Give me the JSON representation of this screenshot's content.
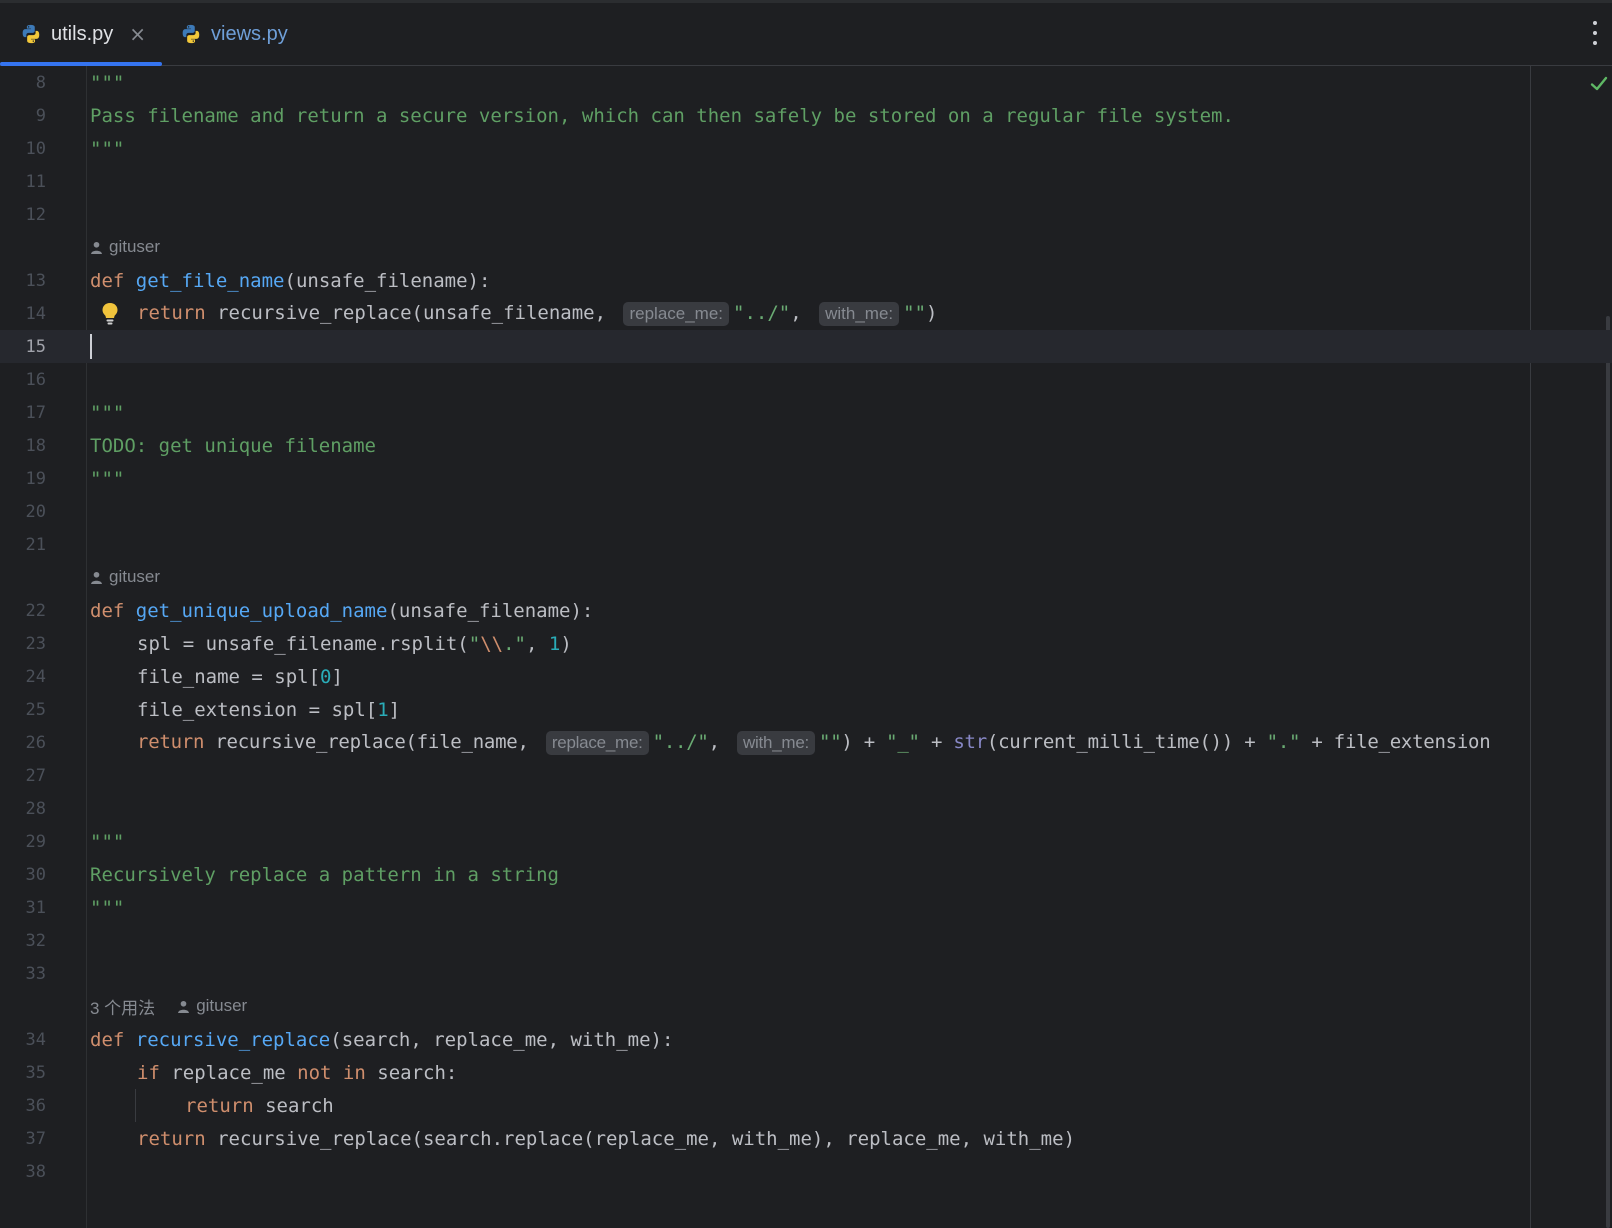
{
  "tabs": [
    {
      "label": "utils.py",
      "close": "×",
      "active": true
    },
    {
      "label": "views.py",
      "active": false
    }
  ],
  "author": "gituser",
  "usages": "3 个用法",
  "lines": {
    "l8": {
      "num": "8",
      "text": "\"\"\""
    },
    "l9": {
      "num": "9",
      "text": "Pass filename and return a secure version, which can then safely be stored on a regular file system."
    },
    "l10": {
      "num": "10",
      "text": "\"\"\""
    },
    "l11": {
      "num": "11"
    },
    "l12": {
      "num": "12"
    },
    "l13": {
      "num": "13",
      "kw": "def",
      "fn": "get_file_name",
      "rest": "(unsafe_filename):"
    },
    "l14": {
      "num": "14",
      "kw": "return",
      "call": "recursive_replace(unsafe_filename, ",
      "hint1": "replace_me:",
      "str1": "\"../\"",
      "sep": ", ",
      "hint2": "with_me:",
      "str2": "\"\"",
      "close": ")"
    },
    "l15": {
      "num": "15"
    },
    "l16": {
      "num": "16"
    },
    "l17": {
      "num": "17",
      "text": "\"\"\""
    },
    "l18": {
      "num": "18",
      "text": "TODO: get unique filename"
    },
    "l19": {
      "num": "19",
      "text": "\"\"\""
    },
    "l20": {
      "num": "20"
    },
    "l21": {
      "num": "21"
    },
    "l22": {
      "num": "22",
      "kw": "def",
      "fn": "get_unique_upload_name",
      "rest": "(unsafe_filename):"
    },
    "l23": {
      "num": "23",
      "a": "spl = unsafe_filename.rsplit(",
      "q1": "\"",
      "esc": "\\\\",
      "q2": ".\"",
      "b": ", ",
      "n": "1",
      "c": ")"
    },
    "l24": {
      "num": "24",
      "a": "file_name = spl[",
      "n": "0",
      "c": "]"
    },
    "l25": {
      "num": "25",
      "a": "file_extension = spl[",
      "n": "1",
      "c": "]"
    },
    "l26": {
      "num": "26",
      "kw": "return",
      "call": "recursive_replace(file_name, ",
      "hint1": "replace_me:",
      "str1": "\"../\"",
      "sep": ", ",
      "hint2": "with_me:",
      "str2": "\"\"",
      "p1": ") + ",
      "str3": "\"_\"",
      "p2": " + ",
      "bi": "str",
      "p3": "(current_milli_time()) + ",
      "str4": "\".\"",
      "p4": " + file_extension"
    },
    "l27": {
      "num": "27"
    },
    "l28": {
      "num": "28"
    },
    "l29": {
      "num": "29",
      "text": "\"\"\""
    },
    "l30": {
      "num": "30",
      "text": "Recursively replace a pattern in a string"
    },
    "l31": {
      "num": "31",
      "text": "\"\"\""
    },
    "l32": {
      "num": "32"
    },
    "l33": {
      "num": "33"
    },
    "l34": {
      "num": "34",
      "kw": "def",
      "fn": "recursive_replace",
      "rest": "(search, replace_me, with_me):"
    },
    "l35": {
      "num": "35",
      "kw": "if",
      "a": " replace_me ",
      "kw2": "not in",
      "b": " search:"
    },
    "l36": {
      "num": "36",
      "kw": "return",
      "a": " search"
    },
    "l37": {
      "num": "37",
      "kw": "return",
      "a": " recursive_replace(search.replace(replace_me, with_me), replace_me, with_me)"
    },
    "l38": {
      "num": "38"
    }
  },
  "colors": {
    "background": "#1e1f22",
    "keyword": "#cf8e6d",
    "function": "#56a8f5",
    "string": "#6aab73",
    "number": "#2aacb8",
    "accent": "#3574f0"
  },
  "icons": [
    "python-file-icon",
    "close-icon",
    "more-options-icon",
    "inspection-ok-icon",
    "person-icon",
    "lightbulb-icon"
  ]
}
